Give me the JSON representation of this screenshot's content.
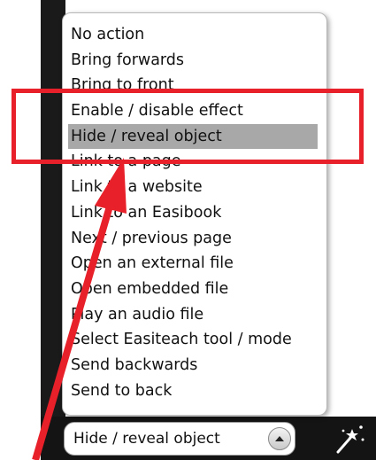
{
  "menu": {
    "items": [
      {
        "label": "No action"
      },
      {
        "label": "Bring forwards"
      },
      {
        "label": "Bring to front"
      },
      {
        "label": "Enable / disable effect"
      },
      {
        "label": "Hide / reveal object",
        "selected": true
      },
      {
        "label": "Link to a page"
      },
      {
        "label": "Link to a website"
      },
      {
        "label": "Link to an Easibook"
      },
      {
        "label": "Next / previous page"
      },
      {
        "label": "Open an external file"
      },
      {
        "label": "Open embedded file"
      },
      {
        "label": "Play an audio file"
      },
      {
        "label": "Select Easiteach tool / mode"
      },
      {
        "label": "Send backwards"
      },
      {
        "label": "Send to back"
      }
    ]
  },
  "select": {
    "value": "Hide / reveal object"
  },
  "icons": {
    "dropdown_button": "chevron-up-icon",
    "tool": "magic-wand-icon"
  },
  "colors": {
    "annotation": "#e8202a",
    "selected_row": "#a8a8a8"
  }
}
